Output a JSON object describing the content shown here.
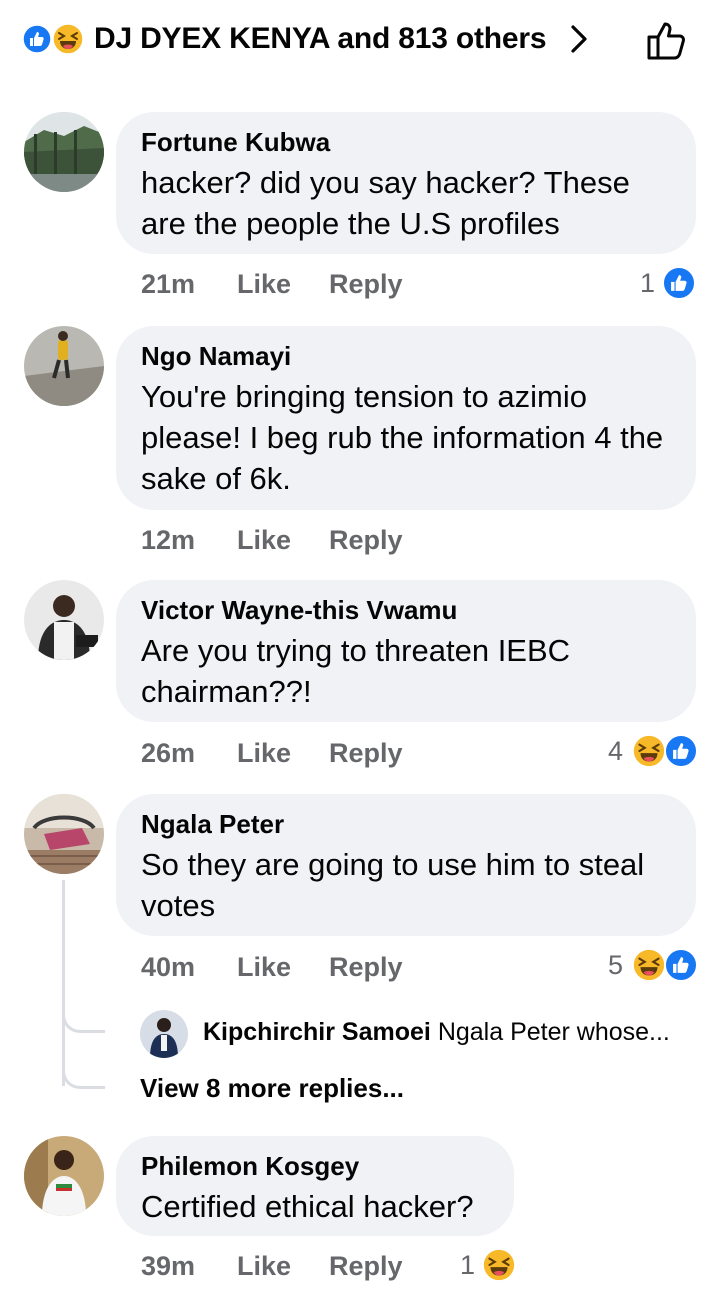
{
  "header": {
    "reactors_text": "DJ DYEX KENYA and 813 others",
    "icons": [
      "like-reaction-icon",
      "haha-reaction-icon",
      "chevron-right-icon",
      "thumbs-up-outline-icon"
    ]
  },
  "comments": [
    {
      "name": "Fortune Kubwa",
      "text": "hacker? did you say hacker? These are the people the U.S profiles",
      "time": "21m",
      "like_label": "Like",
      "reply_label": "Reply",
      "reaction_count": "1",
      "reactions": [
        "like"
      ]
    },
    {
      "name": "Ngo Namayi",
      "text": "You're bringing tension to azimio please! I beg rub the information 4 the sake of 6k.",
      "time": "12m",
      "like_label": "Like",
      "reply_label": "Reply"
    },
    {
      "name": "Victor Wayne-this Vwamu",
      "text": "Are you trying to threaten IEBC chairman??!",
      "time": "26m",
      "like_label": "Like",
      "reply_label": "Reply",
      "reaction_count": "4",
      "reactions": [
        "haha",
        "like"
      ]
    },
    {
      "name": "Ngala Peter",
      "text": "So they are going to use him to steal votes",
      "time": "40m",
      "like_label": "Like",
      "reply_label": "Reply",
      "reaction_count": "5",
      "reactions": [
        "haha",
        "like"
      ]
    },
    {
      "name": "Philemon Kosgey",
      "text": "Certified ethical hacker?",
      "time": "39m",
      "like_label": "Like",
      "reply_label": "Reply",
      "reaction_count": "1",
      "reactions": [
        "haha"
      ]
    }
  ],
  "reply_preview": {
    "name": "Kipchirchir Samoei",
    "text": "Ngala Peter whose..."
  },
  "view_more_label": "View 8 more replies...",
  "colors": {
    "like_blue": "#1877f2",
    "haha_yellow": "#f7b928",
    "bubble_bg": "#f0f2f5",
    "meta_gray": "#65676b"
  }
}
